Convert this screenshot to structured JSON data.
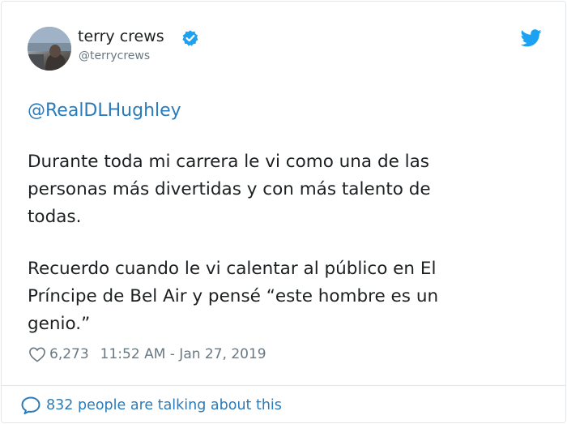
{
  "author": {
    "name": "terry crews",
    "handle": "@terrycrews",
    "verified_icon": "verified-badge-icon",
    "avatar_icon": "profile-photo"
  },
  "platform_icon": "twitter-bird-icon",
  "tweet": {
    "mention": "@RealDLHughley",
    "paragraph1_lines": [
      "Durante toda mi carrera le vi como una de las",
      "personas más divertidas y con más talento de",
      "todas."
    ],
    "paragraph2_lines": [
      "Recuerdo cuando le vi calentar al público en El",
      "Príncipe de Bel Air y pensé “este hombre es un",
      "genio.”"
    ]
  },
  "meta": {
    "likes": "6,273",
    "timestamp": "11:52 AM - Jan 27, 2019"
  },
  "footer": {
    "talking": "832 people are talking about this"
  },
  "colors": {
    "link_blue": "#2b7bb9",
    "twitter_blue": "#1da1f2",
    "secondary_text": "#697882",
    "border": "#e1e8ed"
  }
}
